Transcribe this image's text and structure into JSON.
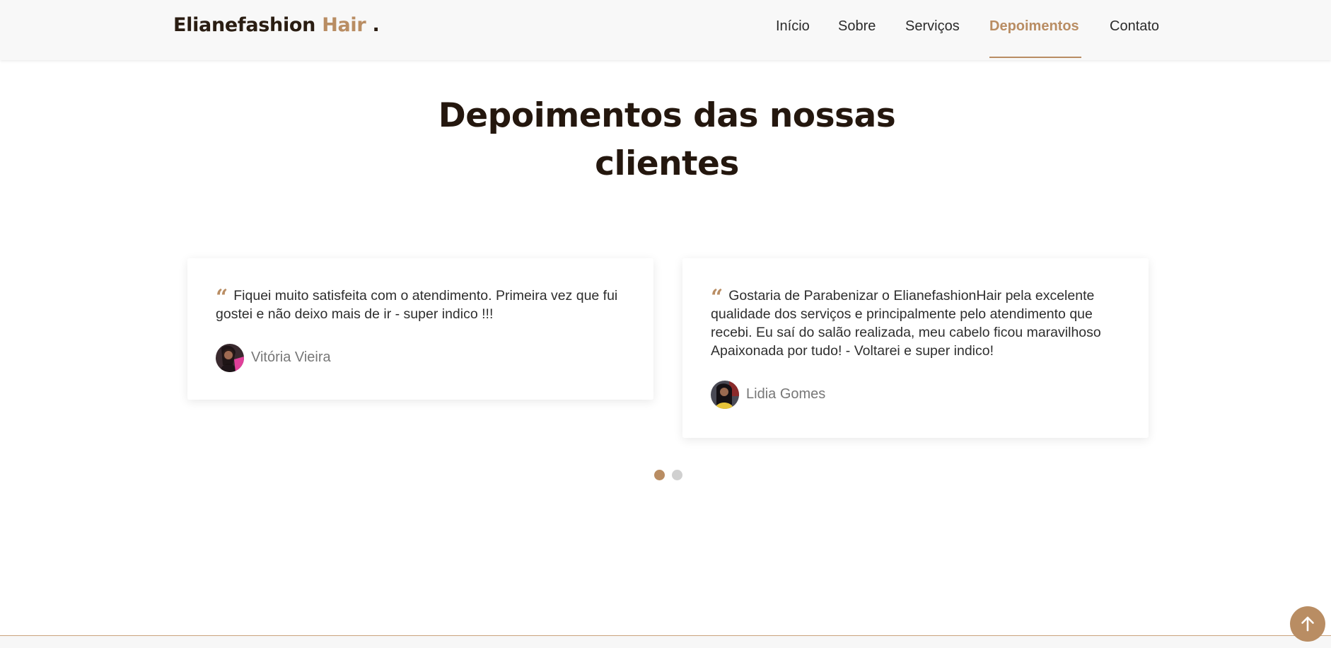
{
  "header": {
    "logo_main": "Elianefashion",
    "logo_accent": "Hair",
    "logo_dot": ".",
    "nav": [
      {
        "label": "Início",
        "active": false
      },
      {
        "label": "Sobre",
        "active": false
      },
      {
        "label": "Serviços",
        "active": false
      },
      {
        "label": "Depoimentos",
        "active": true
      },
      {
        "label": "Contato",
        "active": false
      }
    ]
  },
  "section": {
    "title_line1": "Depoimentos das nossas",
    "title_line2": "clientes"
  },
  "testimonials": [
    {
      "quote": "Fiquei muito satisfeita com o atendimento. Primeira vez que fui gostei e não deixo mais de ir - super indico !!!",
      "author": "Vitória Vieira"
    },
    {
      "quote": "Gostaria de Parabenizar o ElianefashionHair pela excelente qualidade dos serviços e principalmente pelo atendimento que recebi. Eu saí do salão realizada, meu cabelo ficou maravilhoso Apaixonada por tudo! - Voltarei e super indico!",
      "author": "Lidia Gomes"
    }
  ],
  "pagination": {
    "pages": 2,
    "active_page": 1
  },
  "colors": {
    "accent": "#b98d63",
    "heading": "#24170e",
    "dot_inactive": "#d0d0d0"
  },
  "icons": {
    "quote": "quote-icon",
    "back_to_top": "arrow-up-icon"
  }
}
